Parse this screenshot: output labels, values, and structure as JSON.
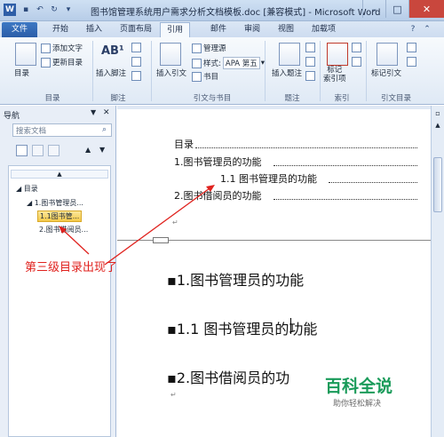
{
  "window": {
    "title": "图书馆管理系统用户需求分析文档模板.doc [兼容模式] - Microsoft Word",
    "minimize": "–",
    "maximize": "□",
    "close": "✕"
  },
  "tabs": [
    "文件",
    "开始",
    "插入",
    "页面布局",
    "引用",
    "邮件",
    "审阅",
    "视图",
    "加载项"
  ],
  "ribbon": {
    "toc_button": "目录",
    "add_text": "添加文字",
    "update_toc": "更新目录",
    "insert_footnote": "插入脚注",
    "ab_sup": "AB¹",
    "insert_citation": "插入引文",
    "manage_sources": "管理源",
    "style_label": "样式:",
    "style_value": "APA 第五",
    "bibliography": "书目",
    "insert_caption": "插入题注",
    "mark_entry": "标记\n索引项",
    "mark_citation": "标记引文",
    "groups": {
      "toc": "目录",
      "footnotes": "脚注",
      "citations": "引文与书目",
      "captions": "题注",
      "index": "索引",
      "toa": "引文目录"
    }
  },
  "nav": {
    "title": "导航",
    "search_placeholder": "搜索文档",
    "tree": [
      {
        "label": "目录"
      },
      {
        "label": "1.图书管理员..."
      },
      {
        "label": "1.1图书管...",
        "selected": true
      },
      {
        "label": "2.图书借阅员..."
      }
    ]
  },
  "document": {
    "toc_title": "目录",
    "toc_entry1": "1.图书管理员的功能",
    "toc_entry2": "1.1 图书管理员的功能",
    "toc_entry3": "2.图书借阅员的功能",
    "h1": "1.图书管理员的功能",
    "h2": "1.1 图书管理员的功能",
    "h3": "2.图书借阅员的功"
  },
  "annotation": {
    "callout": "第三级目录出现了",
    "color": "#e0231f"
  },
  "watermark": {
    "brand": "百科全说",
    "slogan": "助你轻松解决"
  }
}
